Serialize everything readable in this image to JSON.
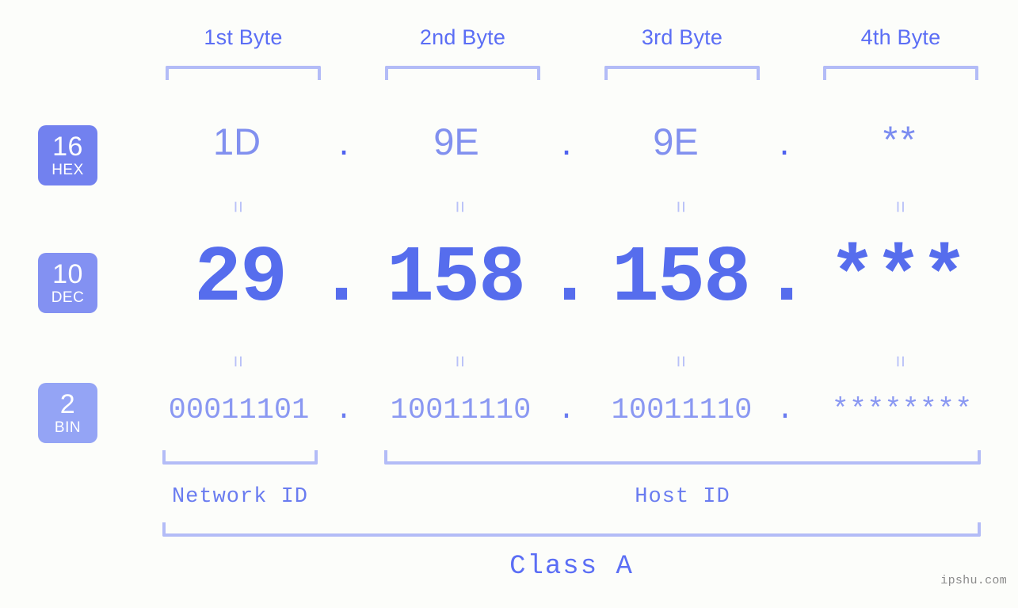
{
  "page": {
    "background_color": "#fcfdfa",
    "accent_color": "#5b6ef5",
    "bracket_color": "#b3bcf7",
    "watermark": "ipshu.com"
  },
  "byte_headers": [
    {
      "label": "1st Byte"
    },
    {
      "label": "2nd Byte"
    },
    {
      "label": "3rd Byte"
    },
    {
      "label": "4th Byte"
    }
  ],
  "bases": [
    {
      "number": "16",
      "name": "HEX",
      "color": "#7281ef"
    },
    {
      "number": "10",
      "name": "DEC",
      "color": "#8391f2"
    },
    {
      "number": "2",
      "name": "BIN",
      "color": "#94a4f5"
    }
  ],
  "rows": {
    "hex": {
      "values": [
        "1D",
        "9E",
        "9E",
        "**"
      ],
      "separator": "."
    },
    "dec": {
      "values": [
        "29",
        "158",
        "158",
        "***"
      ],
      "separator": "."
    },
    "bin": {
      "values": [
        "00011101",
        "10011110",
        "10011110",
        "********"
      ],
      "separator": "."
    }
  },
  "equality_mark": "=",
  "sections": [
    {
      "label": "Network ID"
    },
    {
      "label": "Host ID"
    }
  ],
  "class": {
    "label": "Class A"
  }
}
